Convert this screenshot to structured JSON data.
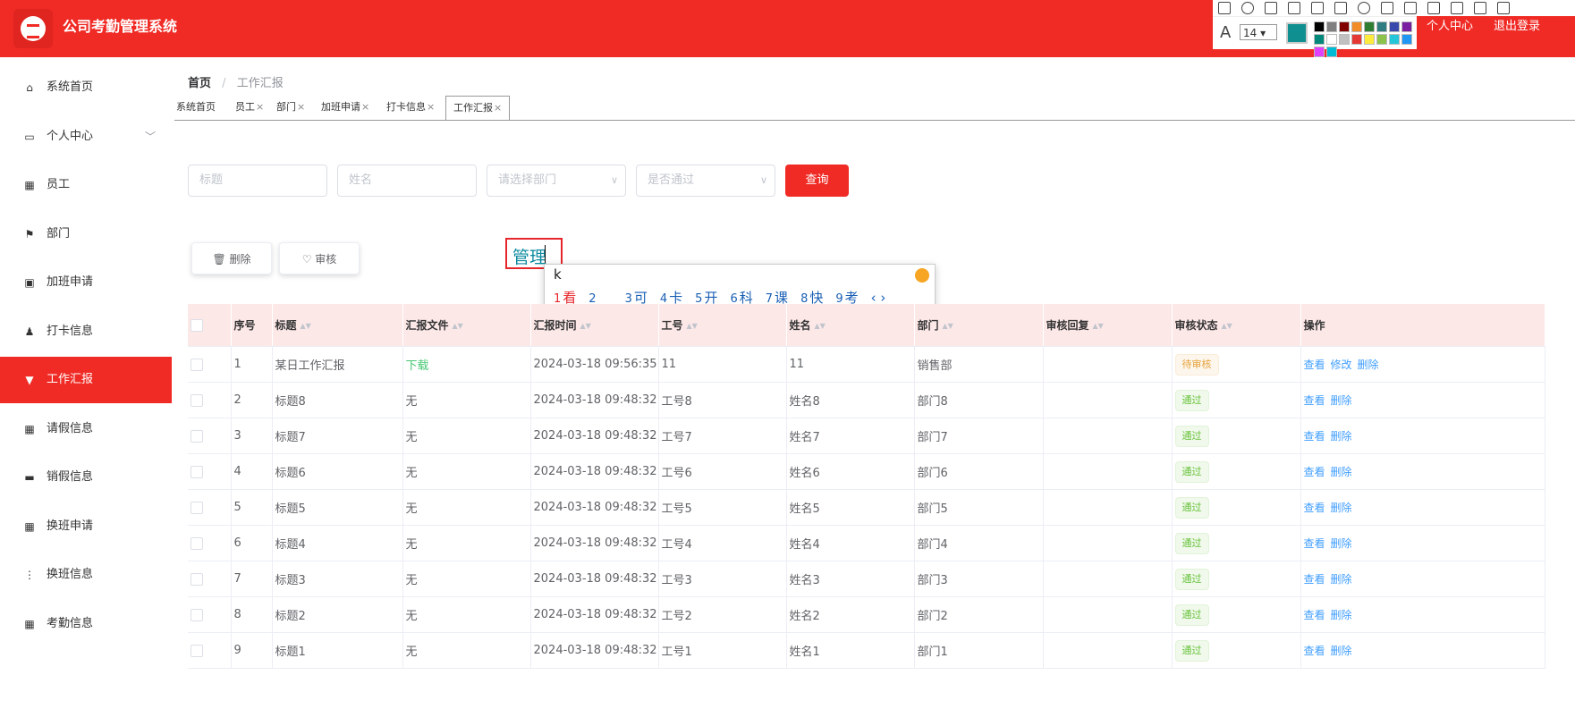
{
  "app": {
    "title": "公司考勤管理系统"
  },
  "header": {
    "personal_center": "个人中心",
    "logout": "退出登录"
  },
  "annotation_toolbar": {
    "font_size": "14",
    "current_color": "#0f8f8f",
    "palette": [
      "#000000",
      "#808080",
      "#800000",
      "#f28c28",
      "#2e7d32",
      "#2f7d80",
      "#3949ab",
      "#7b1fa2",
      "#00897b",
      "#ffffff",
      "#c0c0c0",
      "#e53935",
      "#ffeb3b",
      "#8bc34a",
      "#26c6da",
      "#2196f3",
      "#e040fb",
      "#00bcd4"
    ]
  },
  "sidebar": {
    "items": [
      {
        "label": "系统首页",
        "icon": "home-icon",
        "glyph": "⌂"
      },
      {
        "label": "个人中心",
        "icon": "card-icon",
        "glyph": "▭",
        "expandable": true
      },
      {
        "label": "员工",
        "icon": "grid-icon",
        "glyph": "▦"
      },
      {
        "label": "部门",
        "icon": "flag-icon",
        "glyph": "⚑"
      },
      {
        "label": "加班申请",
        "icon": "clipboard-icon",
        "glyph": "▣"
      },
      {
        "label": "打卡信息",
        "icon": "user-icon",
        "glyph": "♟"
      },
      {
        "label": "工作汇报",
        "icon": "comment-icon",
        "glyph": "▼",
        "active": true
      },
      {
        "label": "请假信息",
        "icon": "grid-icon",
        "glyph": "▦"
      },
      {
        "label": "销假信息",
        "icon": "briefcase-icon",
        "glyph": "▬"
      },
      {
        "label": "换班申请",
        "icon": "grid-icon",
        "glyph": "▦"
      },
      {
        "label": "换班信息",
        "icon": "apps-icon",
        "glyph": "⋮"
      },
      {
        "label": "考勤信息",
        "icon": "grid-icon",
        "glyph": "▦"
      }
    ]
  },
  "breadcrumb": {
    "home": "首页",
    "sep": "/",
    "current": "工作汇报"
  },
  "tabs": [
    {
      "label": "系统首页",
      "closable": false
    },
    {
      "label": "员工",
      "closable": true
    },
    {
      "label": "部门",
      "closable": true
    },
    {
      "label": "加班申请",
      "closable": true
    },
    {
      "label": "打卡信息",
      "closable": true
    },
    {
      "label": "工作汇报",
      "closable": true,
      "active": true
    }
  ],
  "close_glyph": "×",
  "search": {
    "title_placeholder": "标题",
    "name_placeholder": "姓名",
    "dept_placeholder": "请选择部门",
    "pass_placeholder": "是否通过",
    "query_label": "查询"
  },
  "actions": {
    "delete_label": "删除",
    "review_label": "审核"
  },
  "ime": {
    "composed": "管理",
    "code": "k",
    "candidates": [
      {
        "n": "1",
        "c": "看"
      },
      {
        "n": "2",
        "c": ""
      },
      {
        "n": "3",
        "c": "可"
      },
      {
        "n": "4",
        "c": "卡"
      },
      {
        "n": "5",
        "c": "开"
      },
      {
        "n": "6",
        "c": "科"
      },
      {
        "n": "7",
        "c": "课"
      },
      {
        "n": "8",
        "c": "快"
      },
      {
        "n": "9",
        "c": "考"
      }
    ],
    "nav": "‹ ›"
  },
  "table": {
    "columns": [
      "序号",
      "标题",
      "汇报文件",
      "汇报时间",
      "工号",
      "姓名",
      "部门",
      "审核回复",
      "审核状态",
      "操作"
    ],
    "rows": [
      {
        "idx": "1",
        "title": "某日工作汇报",
        "file": "下载",
        "time": "2024-03-18 09:56:35",
        "no": "11",
        "name": "11",
        "dept": "销售部",
        "reply": "",
        "status": "待审核",
        "ops": [
          "查看",
          "修改",
          "删除"
        ]
      },
      {
        "idx": "2",
        "title": "标题8",
        "file": "无",
        "time": "2024-03-18 09:48:32",
        "no": "工号8",
        "name": "姓名8",
        "dept": "部门8",
        "reply": "",
        "status": "通过",
        "ops": [
          "查看",
          "删除"
        ]
      },
      {
        "idx": "3",
        "title": "标题7",
        "file": "无",
        "time": "2024-03-18 09:48:32",
        "no": "工号7",
        "name": "姓名7",
        "dept": "部门7",
        "reply": "",
        "status": "通过",
        "ops": [
          "查看",
          "删除"
        ]
      },
      {
        "idx": "4",
        "title": "标题6",
        "file": "无",
        "time": "2024-03-18 09:48:32",
        "no": "工号6",
        "name": "姓名6",
        "dept": "部门6",
        "reply": "",
        "status": "通过",
        "ops": [
          "查看",
          "删除"
        ]
      },
      {
        "idx": "5",
        "title": "标题5",
        "file": "无",
        "time": "2024-03-18 09:48:32",
        "no": "工号5",
        "name": "姓名5",
        "dept": "部门5",
        "reply": "",
        "status": "通过",
        "ops": [
          "查看",
          "删除"
        ]
      },
      {
        "idx": "6",
        "title": "标题4",
        "file": "无",
        "time": "2024-03-18 09:48:32",
        "no": "工号4",
        "name": "姓名4",
        "dept": "部门4",
        "reply": "",
        "status": "通过",
        "ops": [
          "查看",
          "删除"
        ]
      },
      {
        "idx": "7",
        "title": "标题3",
        "file": "无",
        "time": "2024-03-18 09:48:32",
        "no": "工号3",
        "name": "姓名3",
        "dept": "部门3",
        "reply": "",
        "status": "通过",
        "ops": [
          "查看",
          "删除"
        ]
      },
      {
        "idx": "8",
        "title": "标题2",
        "file": "无",
        "time": "2024-03-18 09:48:32",
        "no": "工号2",
        "name": "姓名2",
        "dept": "部门2",
        "reply": "",
        "status": "通过",
        "ops": [
          "查看",
          "删除"
        ]
      },
      {
        "idx": "9",
        "title": "标题1",
        "file": "无",
        "time": "2024-03-18 09:48:32",
        "no": "工号1",
        "name": "姓名1",
        "dept": "部门1",
        "reply": "",
        "status": "通过",
        "ops": [
          "查看",
          "删除"
        ]
      }
    ]
  }
}
